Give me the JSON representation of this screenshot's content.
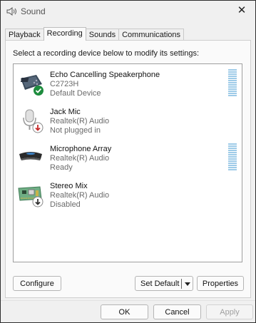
{
  "window": {
    "title": "Sound"
  },
  "tabs": [
    {
      "label": "Playback"
    },
    {
      "label": "Recording"
    },
    {
      "label": "Sounds"
    },
    {
      "label": "Communications"
    }
  ],
  "instruction": "Select a recording device below to modify its settings:",
  "devices": [
    {
      "name": "Echo Cancelling Speakerphone",
      "model": "C2723H",
      "status": "Default Device",
      "icon": "speakerphone-icon",
      "badge": "check-badge-icon",
      "level_meter": true
    },
    {
      "name": "Jack Mic",
      "model": "Realtek(R) Audio",
      "status": "Not plugged in",
      "icon": "microphone-icon",
      "badge": "unplugged-badge-icon",
      "level_meter": false
    },
    {
      "name": "Microphone Array",
      "model": "Realtek(R) Audio",
      "status": "Ready",
      "icon": "microphone-array-icon",
      "badge": "",
      "level_meter": true
    },
    {
      "name": "Stereo Mix",
      "model": "Realtek(R) Audio",
      "status": "Disabled",
      "icon": "circuit-board-icon",
      "badge": "disabled-badge-icon",
      "level_meter": false
    }
  ],
  "buttons": {
    "configure": "Configure",
    "set_default": "Set Default",
    "properties": "Properties",
    "ok": "OK",
    "cancel": "Cancel",
    "apply": "Apply"
  },
  "colors": {
    "meter": "#9ecbe8",
    "check": "#1e8c3e",
    "unplugged": "#c62828"
  }
}
